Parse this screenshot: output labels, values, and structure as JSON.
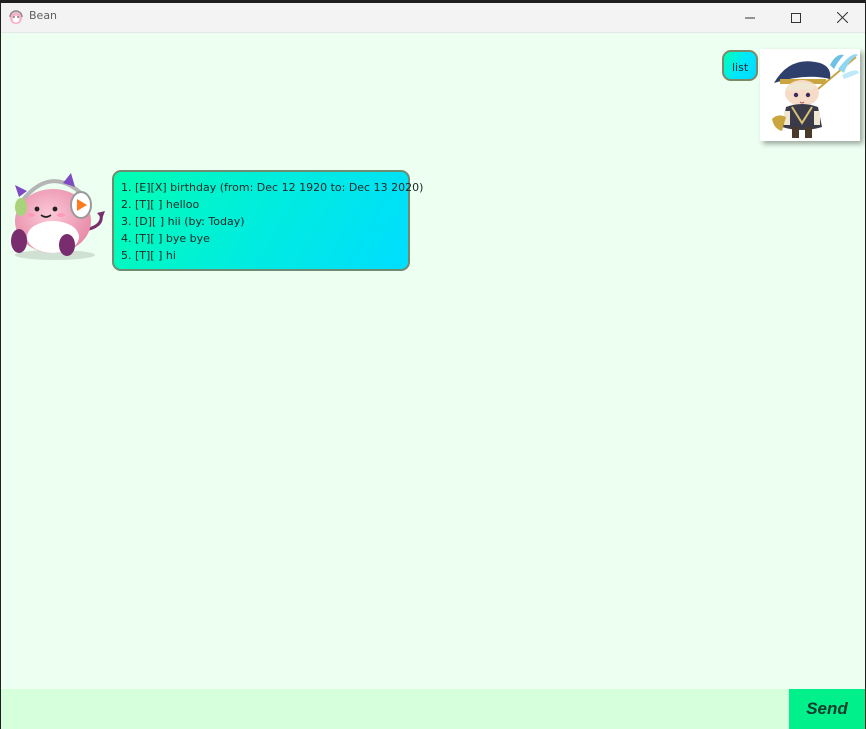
{
  "window": {
    "title": "Bean",
    "controls": [
      "minimize-icon",
      "maximize-icon",
      "close-icon"
    ]
  },
  "colors": {
    "background": "#edfff1",
    "bubble_gradient_start": "#00ffb3",
    "bubble_gradient_end": "#00d9ff",
    "input_background": "#d6ffdc",
    "send_button": "#00f08c"
  },
  "chat": {
    "user_message": "list",
    "bot_tasks": [
      "1. [E][X] birthday (from: Dec 12 1920 to: Dec 13 2020)",
      "2. [T][ ] helloo",
      "3. [D][ ] hii (by: Today)",
      "4. [T][ ] bye bye",
      "5. [T][ ] hi"
    ]
  },
  "input": {
    "value": "",
    "placeholder": ""
  },
  "send_label": "Send"
}
